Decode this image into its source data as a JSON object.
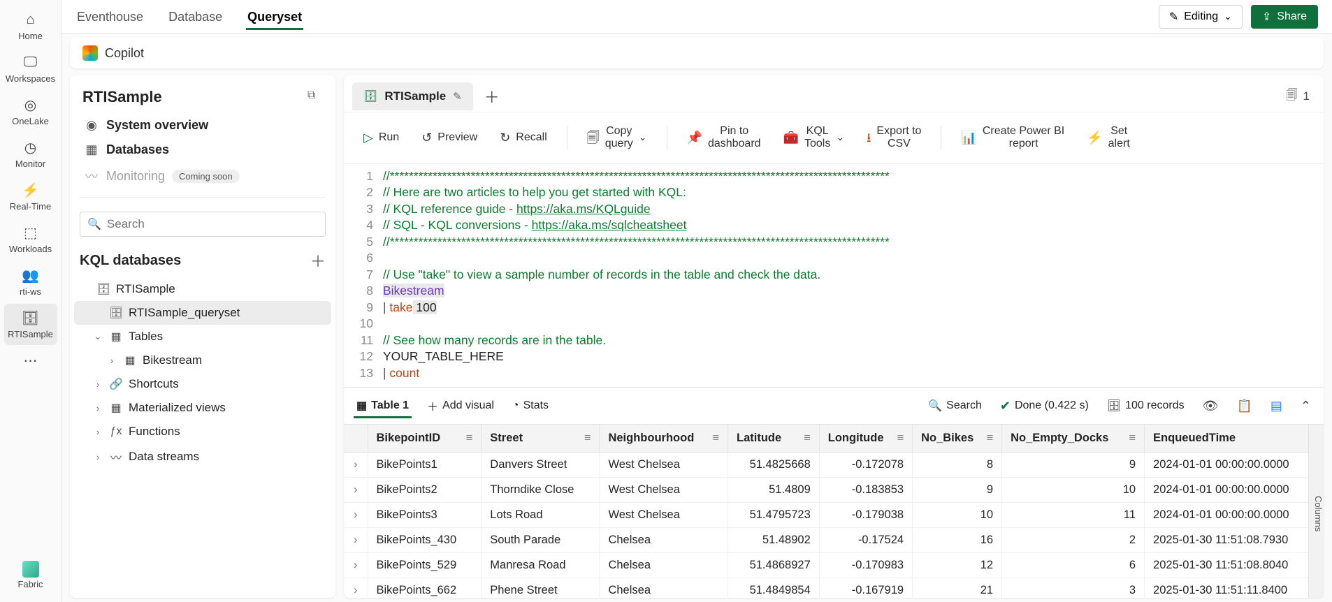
{
  "rail": {
    "items": [
      {
        "label": "Home",
        "icon": "⌂"
      },
      {
        "label": "Workspaces",
        "icon": "🖵"
      },
      {
        "label": "OneLake",
        "icon": "◎"
      },
      {
        "label": "Monitor",
        "icon": "◷"
      },
      {
        "label": "Real-Time",
        "icon": "⚡"
      },
      {
        "label": "Workloads",
        "icon": "⬚"
      },
      {
        "label": "rti-ws",
        "icon": "👥"
      },
      {
        "label": "RTISample",
        "icon": "🗄"
      }
    ],
    "more": "⋯",
    "bottom_label": "Fabric"
  },
  "top_tabs": [
    "Eventhouse",
    "Database",
    "Queryset"
  ],
  "top_active_index": 2,
  "editing_label": "Editing",
  "share_label": "Share",
  "copilot_label": "Copilot",
  "sidebar": {
    "title": "RTISample",
    "nav": [
      {
        "label": "System overview",
        "icon": "◉",
        "bold": true
      },
      {
        "label": "Databases",
        "icon": "▦",
        "bold": true
      },
      {
        "label": "Monitoring",
        "icon": "〰",
        "disabled": true,
        "badge": "Coming soon"
      }
    ],
    "search_placeholder": "Search",
    "subheader": "KQL databases",
    "tree": [
      {
        "label": "RTISample",
        "icon": "🗄",
        "indent": 0,
        "caret": ""
      },
      {
        "label": "RTISample_queryset",
        "icon": "🗄",
        "indent": 1,
        "caret": "",
        "selected": true
      },
      {
        "label": "Tables",
        "icon": "▦",
        "indent": 1,
        "caret": "⌄"
      },
      {
        "label": "Bikestream",
        "icon": "▦",
        "indent": 2,
        "caret": "›"
      },
      {
        "label": "Shortcuts",
        "icon": "🔗",
        "indent": 1,
        "caret": "›"
      },
      {
        "label": "Materialized views",
        "icon": "▦",
        "indent": 1,
        "caret": "›"
      },
      {
        "label": "Functions",
        "icon": "ƒx",
        "indent": 1,
        "caret": "›"
      },
      {
        "label": "Data streams",
        "icon": "〰",
        "indent": 1,
        "caret": "›"
      }
    ]
  },
  "filetab": {
    "name": "RTISample",
    "count": "1"
  },
  "toolbar": {
    "run": "Run",
    "preview": "Preview",
    "recall": "Recall",
    "copy1": "Copy",
    "copy2": "query",
    "pin1": "Pin to",
    "pin2": "dashboard",
    "kql1": "KQL",
    "kql2": "Tools",
    "exp1": "Export to",
    "exp2": "CSV",
    "pbi1": "Create Power BI",
    "pbi2": "report",
    "alert1": "Set",
    "alert2": "alert"
  },
  "editor": {
    "lines": [
      {
        "t": "comment",
        "text": "//*********************************************************************************************************"
      },
      {
        "t": "comment",
        "text": "// Here are two articles to help you get started with KQL:"
      },
      {
        "t": "comment-link",
        "prefix": "// KQL reference guide - ",
        "link": "https://aka.ms/KQLguide"
      },
      {
        "t": "comment-link",
        "prefix": "// SQL - KQL conversions - ",
        "link": "https://aka.ms/sqlcheatsheet"
      },
      {
        "t": "comment",
        "text": "//*********************************************************************************************************"
      },
      {
        "t": "blank",
        "text": ""
      },
      {
        "t": "comment",
        "text": "// Use \"take\" to view a sample number of records in the table and check the data."
      },
      {
        "t": "ident",
        "text": "Bikestream"
      },
      {
        "t": "take",
        "pipe": "| ",
        "kw": "take",
        "num": " 100"
      },
      {
        "t": "blank",
        "text": ""
      },
      {
        "t": "comment",
        "text": "// See how many records are in the table."
      },
      {
        "t": "plain",
        "text": "YOUR_TABLE_HERE"
      },
      {
        "t": "count",
        "pipe": "| ",
        "kw": "count"
      }
    ]
  },
  "results": {
    "table_tab": "Table 1",
    "add_visual": "Add visual",
    "stats": "Stats",
    "search": "Search",
    "done": "Done (0.422 s)",
    "records": "100 records",
    "columns_rail": "Columns",
    "columns": [
      "BikepointID",
      "Street",
      "Neighbourhood",
      "Latitude",
      "Longitude",
      "No_Bikes",
      "No_Empty_Docks",
      "EnqueuedTime"
    ],
    "rows": [
      [
        "BikePoints1",
        "Danvers Street",
        "West Chelsea",
        "51.4825668",
        "-0.172078",
        "8",
        "9",
        "2024-01-01 00:00:00.0000"
      ],
      [
        "BikePoints2",
        "Thorndike Close",
        "West Chelsea",
        "51.4809",
        "-0.183853",
        "9",
        "10",
        "2024-01-01 00:00:00.0000"
      ],
      [
        "BikePoints3",
        "Lots Road",
        "West Chelsea",
        "51.4795723",
        "-0.179038",
        "10",
        "11",
        "2024-01-01 00:00:00.0000"
      ],
      [
        "BikePoints_430",
        "South Parade",
        "Chelsea",
        "51.48902",
        "-0.17524",
        "16",
        "2",
        "2025-01-30 11:51:08.7930"
      ],
      [
        "BikePoints_529",
        "Manresa Road",
        "Chelsea",
        "51.4868927",
        "-0.170983",
        "12",
        "6",
        "2025-01-30 11:51:08.8040"
      ],
      [
        "BikePoints_662",
        "Phene Street",
        "Chelsea",
        "51.4849854",
        "-0.167919",
        "21",
        "3",
        "2025-01-30 11:51:11.8400"
      ]
    ]
  }
}
